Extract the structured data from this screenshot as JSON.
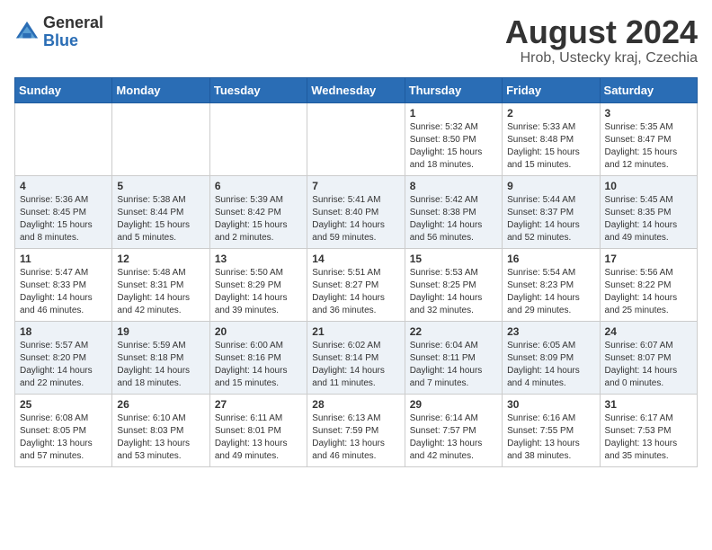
{
  "header": {
    "logo_general": "General",
    "logo_blue": "Blue",
    "title": "August 2024",
    "subtitle": "Hrob, Ustecky kraj, Czechia"
  },
  "days_of_week": [
    "Sunday",
    "Monday",
    "Tuesday",
    "Wednesday",
    "Thursday",
    "Friday",
    "Saturday"
  ],
  "weeks": [
    {
      "days": [
        {
          "date": "",
          "info": ""
        },
        {
          "date": "",
          "info": ""
        },
        {
          "date": "",
          "info": ""
        },
        {
          "date": "",
          "info": ""
        },
        {
          "date": "1",
          "info": "Sunrise: 5:32 AM\nSunset: 8:50 PM\nDaylight: 15 hours\nand 18 minutes."
        },
        {
          "date": "2",
          "info": "Sunrise: 5:33 AM\nSunset: 8:48 PM\nDaylight: 15 hours\nand 15 minutes."
        },
        {
          "date": "3",
          "info": "Sunrise: 5:35 AM\nSunset: 8:47 PM\nDaylight: 15 hours\nand 12 minutes."
        }
      ]
    },
    {
      "days": [
        {
          "date": "4",
          "info": "Sunrise: 5:36 AM\nSunset: 8:45 PM\nDaylight: 15 hours\nand 8 minutes."
        },
        {
          "date": "5",
          "info": "Sunrise: 5:38 AM\nSunset: 8:44 PM\nDaylight: 15 hours\nand 5 minutes."
        },
        {
          "date": "6",
          "info": "Sunrise: 5:39 AM\nSunset: 8:42 PM\nDaylight: 15 hours\nand 2 minutes."
        },
        {
          "date": "7",
          "info": "Sunrise: 5:41 AM\nSunset: 8:40 PM\nDaylight: 14 hours\nand 59 minutes."
        },
        {
          "date": "8",
          "info": "Sunrise: 5:42 AM\nSunset: 8:38 PM\nDaylight: 14 hours\nand 56 minutes."
        },
        {
          "date": "9",
          "info": "Sunrise: 5:44 AM\nSunset: 8:37 PM\nDaylight: 14 hours\nand 52 minutes."
        },
        {
          "date": "10",
          "info": "Sunrise: 5:45 AM\nSunset: 8:35 PM\nDaylight: 14 hours\nand 49 minutes."
        }
      ]
    },
    {
      "days": [
        {
          "date": "11",
          "info": "Sunrise: 5:47 AM\nSunset: 8:33 PM\nDaylight: 14 hours\nand 46 minutes."
        },
        {
          "date": "12",
          "info": "Sunrise: 5:48 AM\nSunset: 8:31 PM\nDaylight: 14 hours\nand 42 minutes."
        },
        {
          "date": "13",
          "info": "Sunrise: 5:50 AM\nSunset: 8:29 PM\nDaylight: 14 hours\nand 39 minutes."
        },
        {
          "date": "14",
          "info": "Sunrise: 5:51 AM\nSunset: 8:27 PM\nDaylight: 14 hours\nand 36 minutes."
        },
        {
          "date": "15",
          "info": "Sunrise: 5:53 AM\nSunset: 8:25 PM\nDaylight: 14 hours\nand 32 minutes."
        },
        {
          "date": "16",
          "info": "Sunrise: 5:54 AM\nSunset: 8:23 PM\nDaylight: 14 hours\nand 29 minutes."
        },
        {
          "date": "17",
          "info": "Sunrise: 5:56 AM\nSunset: 8:22 PM\nDaylight: 14 hours\nand 25 minutes."
        }
      ]
    },
    {
      "days": [
        {
          "date": "18",
          "info": "Sunrise: 5:57 AM\nSunset: 8:20 PM\nDaylight: 14 hours\nand 22 minutes."
        },
        {
          "date": "19",
          "info": "Sunrise: 5:59 AM\nSunset: 8:18 PM\nDaylight: 14 hours\nand 18 minutes."
        },
        {
          "date": "20",
          "info": "Sunrise: 6:00 AM\nSunset: 8:16 PM\nDaylight: 14 hours\nand 15 minutes."
        },
        {
          "date": "21",
          "info": "Sunrise: 6:02 AM\nSunset: 8:14 PM\nDaylight: 14 hours\nand 11 minutes."
        },
        {
          "date": "22",
          "info": "Sunrise: 6:04 AM\nSunset: 8:11 PM\nDaylight: 14 hours\nand 7 minutes."
        },
        {
          "date": "23",
          "info": "Sunrise: 6:05 AM\nSunset: 8:09 PM\nDaylight: 14 hours\nand 4 minutes."
        },
        {
          "date": "24",
          "info": "Sunrise: 6:07 AM\nSunset: 8:07 PM\nDaylight: 14 hours\nand 0 minutes."
        }
      ]
    },
    {
      "days": [
        {
          "date": "25",
          "info": "Sunrise: 6:08 AM\nSunset: 8:05 PM\nDaylight: 13 hours\nand 57 minutes."
        },
        {
          "date": "26",
          "info": "Sunrise: 6:10 AM\nSunset: 8:03 PM\nDaylight: 13 hours\nand 53 minutes."
        },
        {
          "date": "27",
          "info": "Sunrise: 6:11 AM\nSunset: 8:01 PM\nDaylight: 13 hours\nand 49 minutes."
        },
        {
          "date": "28",
          "info": "Sunrise: 6:13 AM\nSunset: 7:59 PM\nDaylight: 13 hours\nand 46 minutes."
        },
        {
          "date": "29",
          "info": "Sunrise: 6:14 AM\nSunset: 7:57 PM\nDaylight: 13 hours\nand 42 minutes."
        },
        {
          "date": "30",
          "info": "Sunrise: 6:16 AM\nSunset: 7:55 PM\nDaylight: 13 hours\nand 38 minutes."
        },
        {
          "date": "31",
          "info": "Sunrise: 6:17 AM\nSunset: 7:53 PM\nDaylight: 13 hours\nand 35 minutes."
        }
      ]
    }
  ]
}
